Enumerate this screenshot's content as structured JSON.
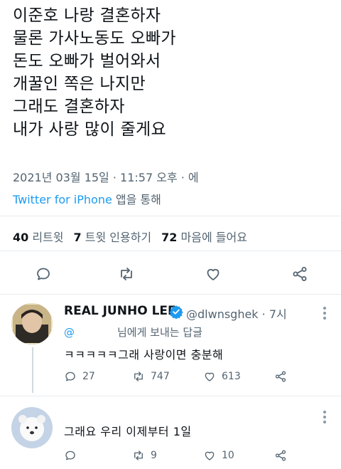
{
  "tweet": {
    "lines": [
      "이준호 나랑 결혼하자",
      "물론 가사노동도 오빠가",
      "돈도 오빠가 벌어와서",
      "개꿀인 쪽은 나지만",
      "그래도 결혼하자",
      "내가 사랑 많이 줄게요"
    ],
    "timestamp": "2021년 03월 15일 · 11:57 오후 · 에",
    "source_app": "Twitter for iPhone",
    "source_suffix": " 앱을 통해"
  },
  "stats": {
    "retweets_count": "40",
    "retweets_label": " 리트윗",
    "quotes_count": "7",
    "quotes_label": " 트윗 인용하기",
    "likes_count": "72",
    "likes_label": " 마음에 들어요"
  },
  "replies": [
    {
      "display_name": "REAL JUNHO LEE",
      "handle": "@dlwnsghek · 7시",
      "replying_at": "@",
      "replying_text": "님에게 보내는 답글",
      "text": "ㅋㅋㅋㅋㅋ그래 사랑이면 충분해",
      "reply_count": "27",
      "retweet_count": "747",
      "like_count": "613"
    },
    {
      "text": "그래요 우리 이제부터 1일",
      "reply_count": "",
      "retweet_count": "9",
      "like_count": "10"
    }
  ],
  "colors": {
    "accent": "#1d9bf0",
    "text": "#0f1419",
    "secondary": "#536471",
    "divider": "#e6ecf0"
  }
}
